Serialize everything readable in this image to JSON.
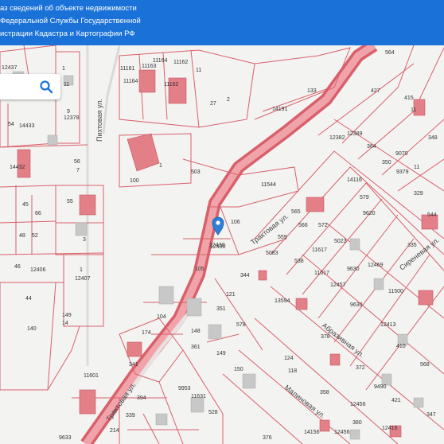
{
  "header": {
    "line1": "аз сведений об объекте недвижимости",
    "line2": "Федеральной Службы Государственной",
    "line3": "истрации Кадастра и Картографии РФ"
  },
  "map": {
    "streets": [
      {
        "name": "Пихтовая ул."
      },
      {
        "name": "Трактовая ул."
      },
      {
        "name": "Трактовая ул."
      },
      {
        "name": "Абразивная ул."
      },
      {
        "name": "Сиреневая ул."
      },
      {
        "name": "Малиновая ул."
      }
    ],
    "parcels": [
      {
        "label": "12437"
      },
      {
        "label": "1"
      },
      {
        "label": "11"
      },
      {
        "label": "12378"
      },
      {
        "label": "9"
      },
      {
        "label": "54"
      },
      {
        "label": "14433"
      },
      {
        "label": "14432"
      },
      {
        "label": "56"
      },
      {
        "label": "7"
      },
      {
        "label": "45"
      },
      {
        "label": "66"
      },
      {
        "label": "55"
      },
      {
        "label": "48"
      },
      {
        "label": "52"
      },
      {
        "label": "3"
      },
      {
        "label": "46"
      },
      {
        "label": "12406"
      },
      {
        "label": "1"
      },
      {
        "label": "12407"
      },
      {
        "label": "44"
      },
      {
        "label": "140"
      },
      {
        "label": "149"
      },
      {
        "label": "14"
      },
      {
        "label": "11161"
      },
      {
        "label": "11164"
      },
      {
        "label": "11163"
      },
      {
        "label": "11162"
      },
      {
        "label": "11164"
      },
      {
        "label": "11162"
      },
      {
        "label": "11"
      },
      {
        "label": "2"
      },
      {
        "label": "27"
      },
      {
        "label": "133"
      },
      {
        "label": "14191"
      },
      {
        "label": "100"
      },
      {
        "label": "1"
      },
      {
        "label": "503"
      },
      {
        "label": "11544"
      },
      {
        "label": "106"
      },
      {
        "label": "12430"
      },
      {
        "label": "105"
      },
      {
        "label": "104"
      },
      {
        "label": "344"
      },
      {
        "label": "121"
      },
      {
        "label": "351"
      },
      {
        "label": "578"
      },
      {
        "label": "148"
      },
      {
        "label": "361"
      },
      {
        "label": "149"
      },
      {
        "label": "150"
      },
      {
        "label": "341"
      },
      {
        "label": "174"
      },
      {
        "label": "11601"
      },
      {
        "label": "394"
      },
      {
        "label": "339"
      },
      {
        "label": "9633"
      },
      {
        "label": "214"
      },
      {
        "label": "9953"
      },
      {
        "label": "11631"
      },
      {
        "label": "528"
      },
      {
        "label": "564"
      },
      {
        "label": "427"
      },
      {
        "label": "415"
      },
      {
        "label": "11"
      },
      {
        "label": "348"
      },
      {
        "label": "12389"
      },
      {
        "label": "364"
      },
      {
        "label": "350"
      },
      {
        "label": "9379"
      },
      {
        "label": "11"
      },
      {
        "label": "329"
      },
      {
        "label": "579"
      },
      {
        "label": "565"
      },
      {
        "label": "572"
      },
      {
        "label": "5023"
      },
      {
        "label": "566"
      },
      {
        "label": "559"
      },
      {
        "label": "538"
      },
      {
        "label": "5083"
      },
      {
        "label": "335"
      },
      {
        "label": "11500"
      },
      {
        "label": "11617"
      },
      {
        "label": "12457"
      },
      {
        "label": "12469"
      },
      {
        "label": "13594"
      },
      {
        "label": "378"
      },
      {
        "label": "9630"
      },
      {
        "label": "12413"
      },
      {
        "label": "410"
      },
      {
        "label": "372"
      },
      {
        "label": "9490"
      },
      {
        "label": "358"
      },
      {
        "label": "421"
      },
      {
        "label": "347"
      },
      {
        "label": "380"
      },
      {
        "label": "12456"
      },
      {
        "label": "12416"
      },
      {
        "label": "14156"
      },
      {
        "label": "9630"
      },
      {
        "label": "11617"
      },
      {
        "label": "544"
      },
      {
        "label": "124"
      },
      {
        "label": "118"
      },
      {
        "label": "12456"
      },
      {
        "label": "376"
      },
      {
        "label": "568"
      },
      {
        "label": "9620"
      },
      {
        "label": "12382"
      },
      {
        "label": "14116"
      },
      {
        "label": "9070"
      }
    ],
    "pin_label": "12430"
  },
  "search": {
    "icon": "search-icon"
  },
  "colors": {
    "header": "#1a72d8",
    "road": "#e26a73",
    "road_fill": "#f0a4aa",
    "boundary": "#d9606b",
    "building": "#e27f87",
    "ground": "#f3f3f1",
    "pin": "#2f7fd8"
  }
}
